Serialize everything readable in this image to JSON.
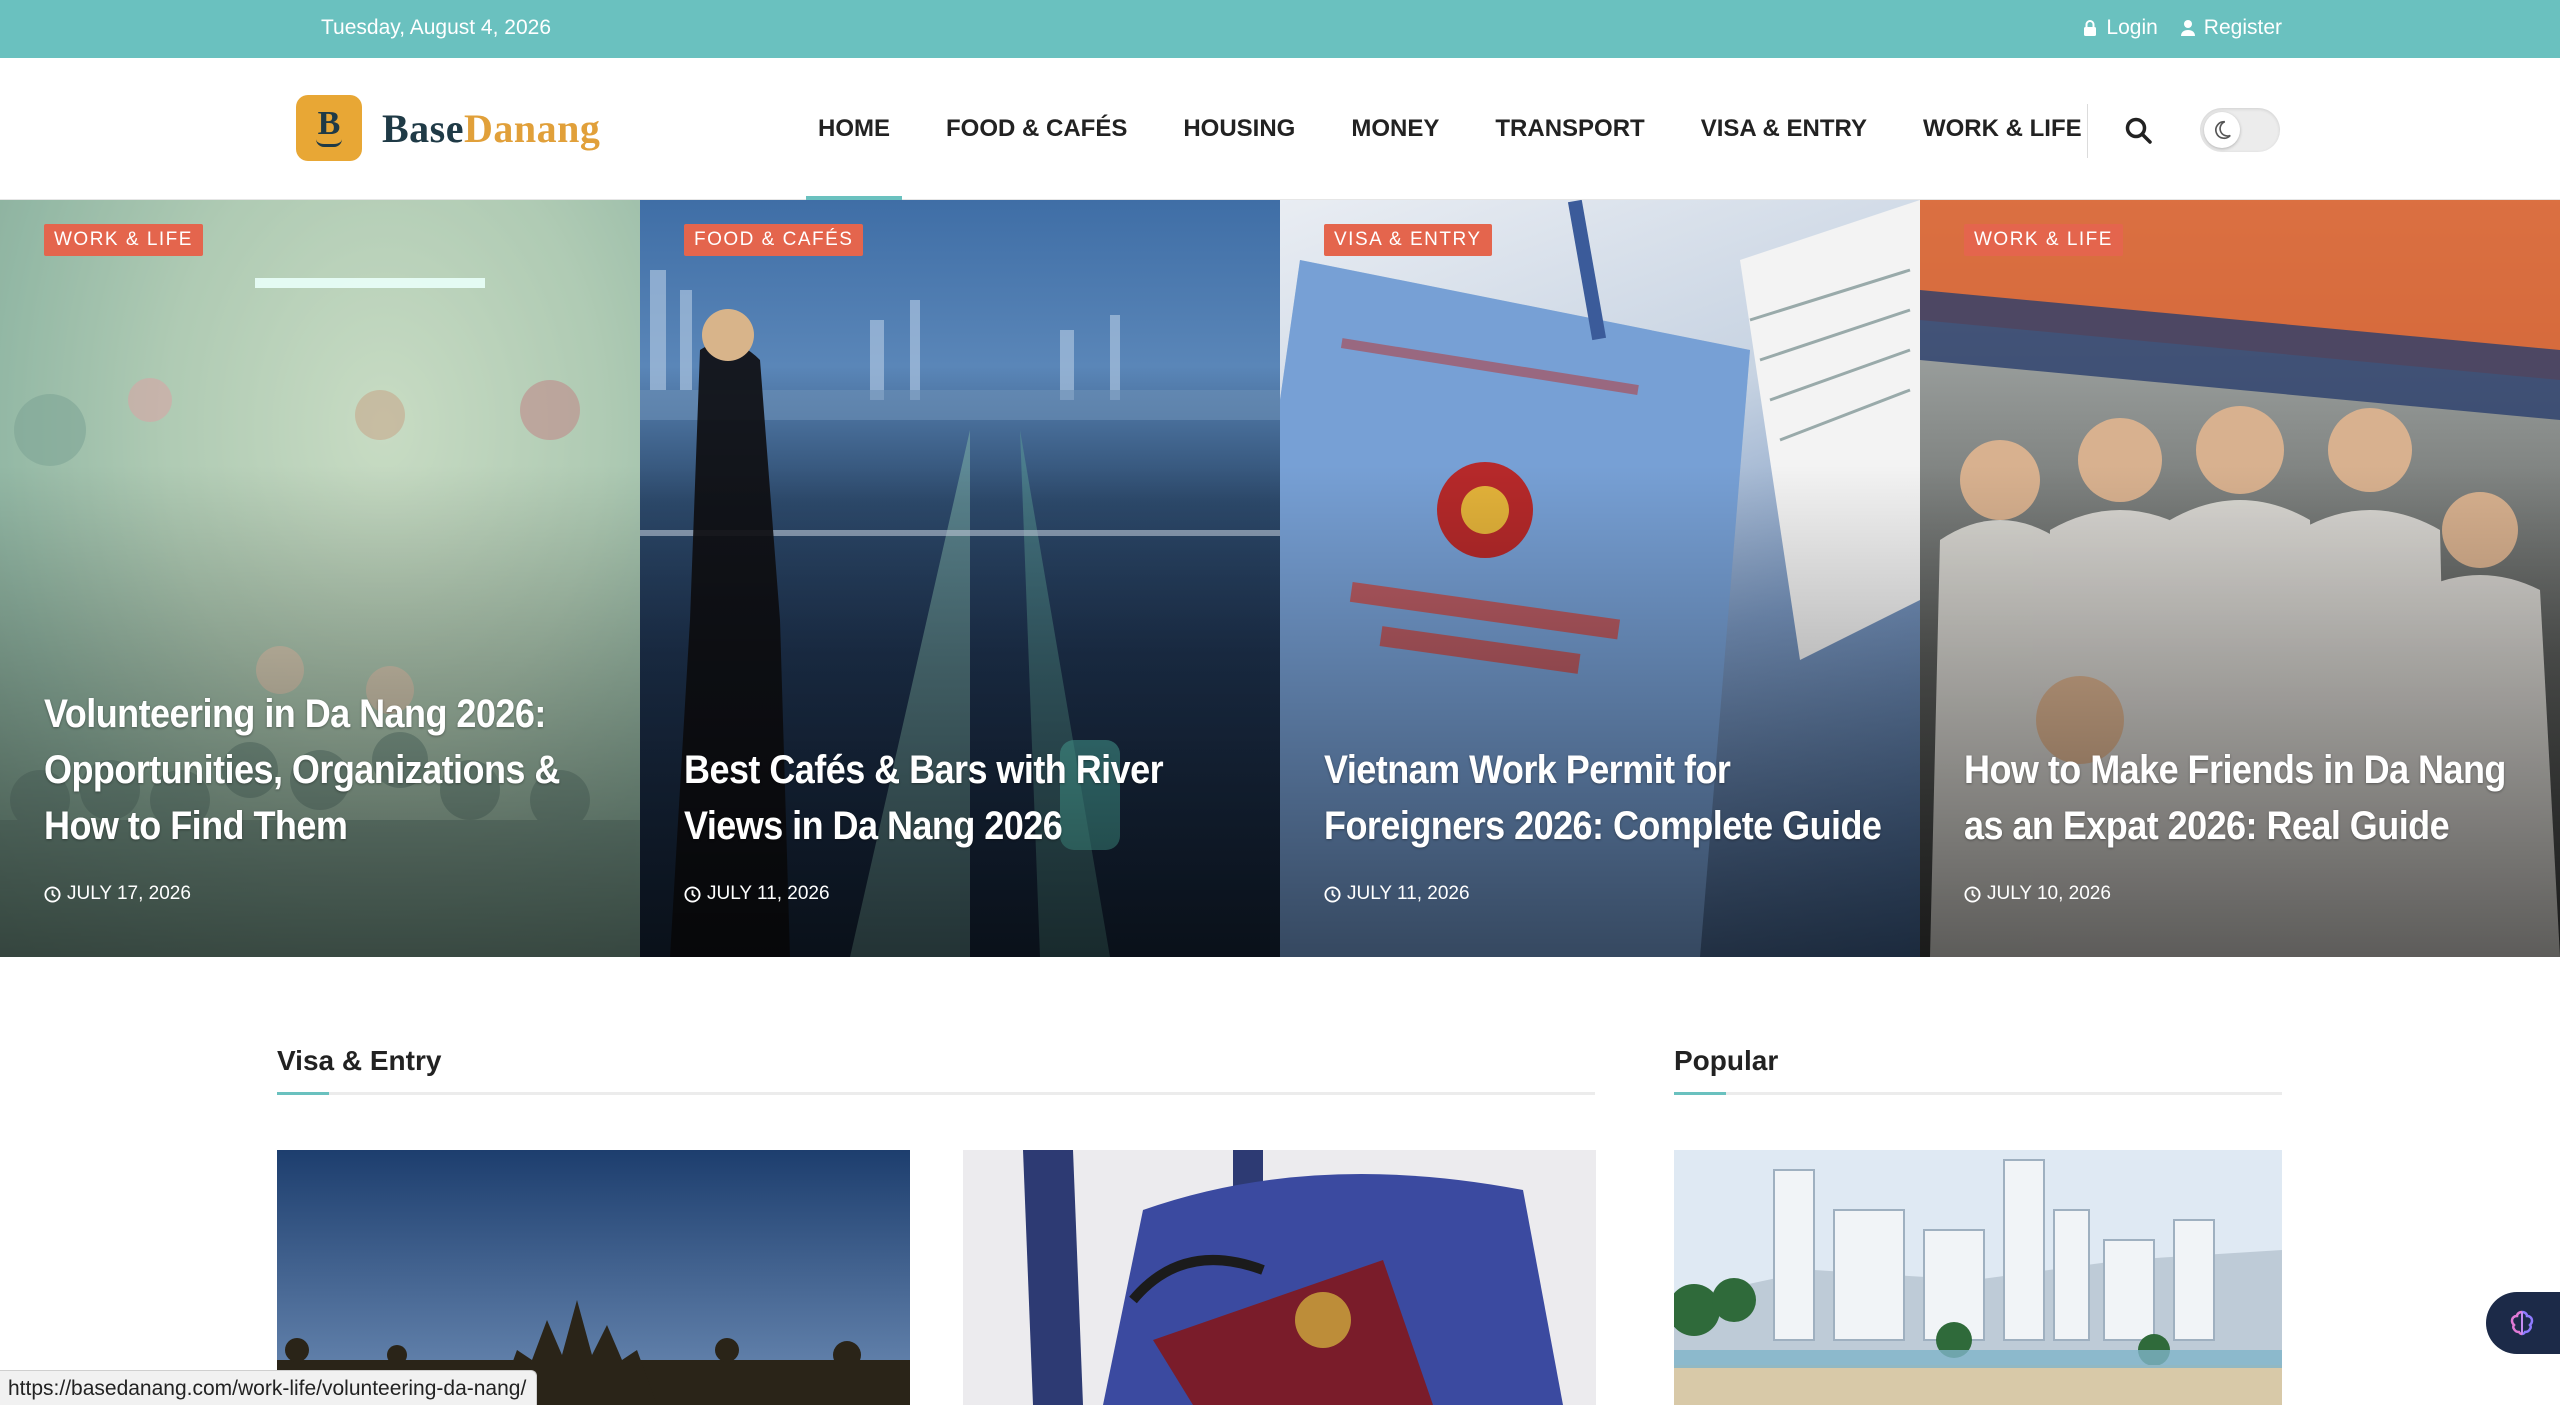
{
  "topbar": {
    "date": "Tuesday, August 4, 2026",
    "login": "Login",
    "register": "Register"
  },
  "logo": {
    "part1": "Base",
    "part2": "Danang",
    "badge_letter": "B"
  },
  "nav": {
    "items": [
      "HOME",
      "FOOD & CAFÉS",
      "HOUSING",
      "MONEY",
      "TRANSPORT",
      "VISA & ENTRY",
      "WORK & LIFE"
    ],
    "active": "HOME"
  },
  "hero": [
    {
      "category": "WORK & LIFE",
      "title": "Volunteering in Da Nang 2026: Opportunities, Organizations & How to Find Them",
      "date": "JULY 17, 2026"
    },
    {
      "category": "FOOD & CAFÉS",
      "title": "Best Cafés & Bars with River Views in Da Nang 2026",
      "date": "JULY 11, 2026"
    },
    {
      "category": "VISA & ENTRY",
      "title": "Vietnam Work Permit for Foreigners 2026: Complete Guide",
      "date": "JULY 11, 2026"
    },
    {
      "category": "WORK & LIFE",
      "title": "How to Make Friends in Da Nang as an Expat 2026: Real Guide",
      "date": "JULY 10, 2026"
    }
  ],
  "sections": {
    "visa": "Visa & Entry",
    "popular": "Popular"
  },
  "status_url": "https://basedanang.com/work-life/volunteering-da-nang/",
  "colors": {
    "accent": "#6ac1bf",
    "tag": "#e4654d",
    "brand_gold": "#e1a03a",
    "brand_dark": "#1f3a46"
  }
}
